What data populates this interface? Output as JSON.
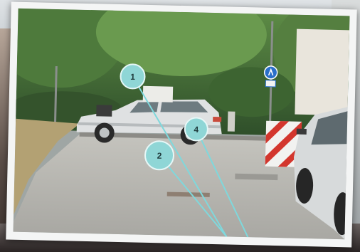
{
  "markers": [
    {
      "id": "1",
      "label": "1"
    },
    {
      "id": "2",
      "label": "2"
    },
    {
      "id": "4",
      "label": "4"
    }
  ],
  "colors": {
    "marker_fill": "#8fd6d6",
    "marker_line": "#7fd8dc",
    "road": "#b7b6b1",
    "foliage": "#3f6a34"
  },
  "icons": {
    "traffic_sign": "blue-round-arrow-sign",
    "barrier": "red-white-striped-barrier"
  }
}
